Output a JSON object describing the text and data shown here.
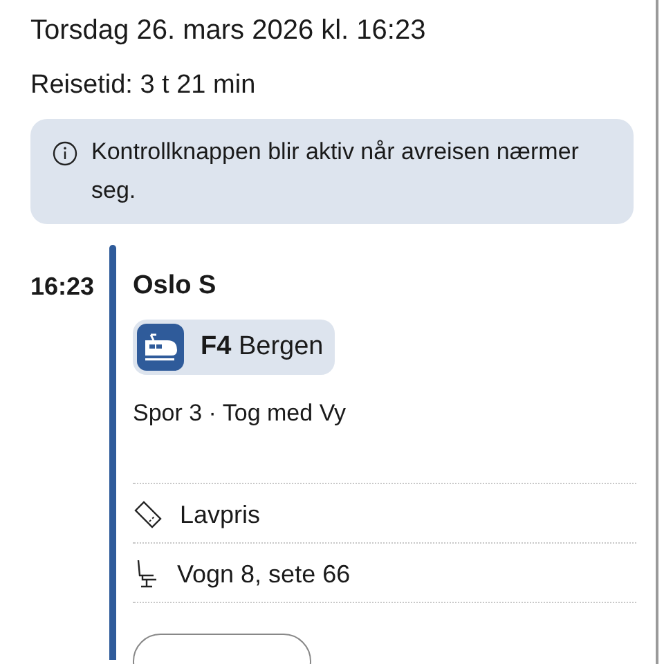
{
  "date_line": "Torsdag 26. mars 2026 kl. 16:23",
  "travel_time": "Reisetid: 3 t 21 min",
  "info_banner": {
    "text": "Kontrollknappen blir aktiv når avreisen nærmer seg."
  },
  "legs": [
    {
      "time": "16:23",
      "station": "Oslo S",
      "line": {
        "code": "F4",
        "destination": "Bergen",
        "kind": "train"
      },
      "details": "Spor 3 · Tog med Vy",
      "items": [
        {
          "kind": "ticket",
          "text": "Lavpris"
        },
        {
          "kind": "seat",
          "text": "Vogn 8, sete 66"
        }
      ]
    }
  ]
}
